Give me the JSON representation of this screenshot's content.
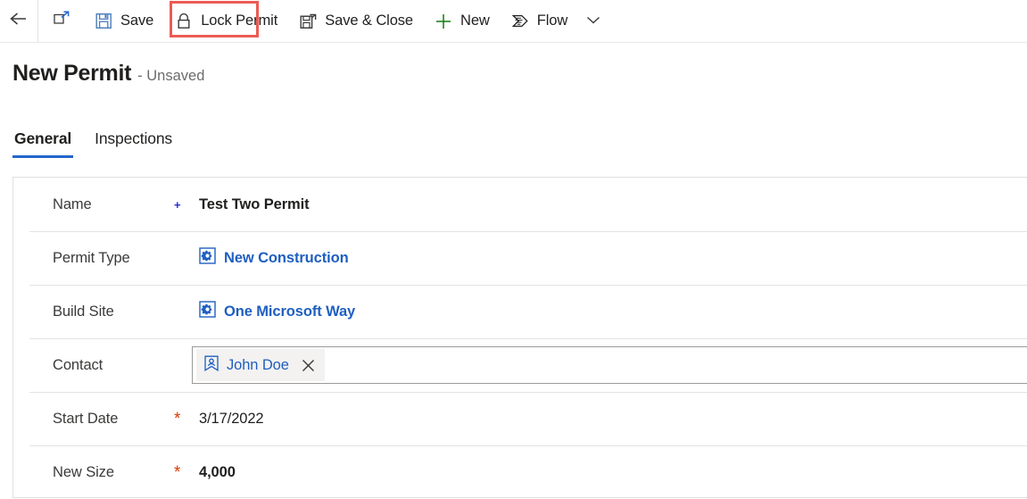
{
  "commandbar": {
    "back": {
      "icon": "back-arrow-icon",
      "label": "Back"
    },
    "popout": {
      "icon": "popout-icon",
      "label": "Open in new window"
    },
    "buttons": [
      {
        "label": "Save",
        "icon": "save-floppy-icon",
        "highlighted": true
      },
      {
        "label": "Lock Permit",
        "icon": "lock-icon",
        "highlighted": false
      },
      {
        "label": "Save & Close",
        "icon": "save-and-close-icon",
        "highlighted": false
      },
      {
        "label": "New",
        "icon": "plus-icon",
        "highlighted": false
      },
      {
        "label": "Flow",
        "icon": "flow-icon",
        "highlighted": false
      }
    ],
    "overflow": {
      "icon": "chevron-down-icon",
      "label": "More commands"
    }
  },
  "header": {
    "title": "New Permit",
    "status": "- Unsaved"
  },
  "tabs": [
    {
      "label": "General",
      "active": true
    },
    {
      "label": "Inspections",
      "active": false
    }
  ],
  "form": {
    "rows": [
      {
        "label": "Name",
        "marker": "+",
        "marker_type": "recommended",
        "value": "Test Two Permit",
        "value_type": "strong"
      },
      {
        "label": "Permit Type",
        "marker": "",
        "marker_type": "none",
        "value": "New Construction",
        "value_type": "lookup",
        "icon": "entity-record-icon"
      },
      {
        "label": "Build Site",
        "marker": "",
        "marker_type": "none",
        "value": "One Microsoft Way",
        "value_type": "lookup",
        "icon": "entity-record-icon"
      },
      {
        "label": "Contact",
        "marker": "",
        "marker_type": "none",
        "value": "John Doe",
        "value_type": "contact-pill",
        "icon": "contact-person-icon",
        "remove_icon": "close-x-icon"
      },
      {
        "label": "Start Date",
        "marker": "*",
        "marker_type": "required",
        "value": "3/17/2022",
        "value_type": "plain"
      },
      {
        "label": "New Size",
        "marker": "*",
        "marker_type": "required",
        "value": "4,000",
        "value_type": "strong"
      }
    ]
  },
  "colors": {
    "accent": "#2266cc",
    "link": "#1f5fbf",
    "required": "#d83b01",
    "recommended": "#2b2bdd",
    "highlight_box": "#ec5b54",
    "new_plus_green": "#107c10",
    "save_icon_blue": "#4a7ebb"
  }
}
